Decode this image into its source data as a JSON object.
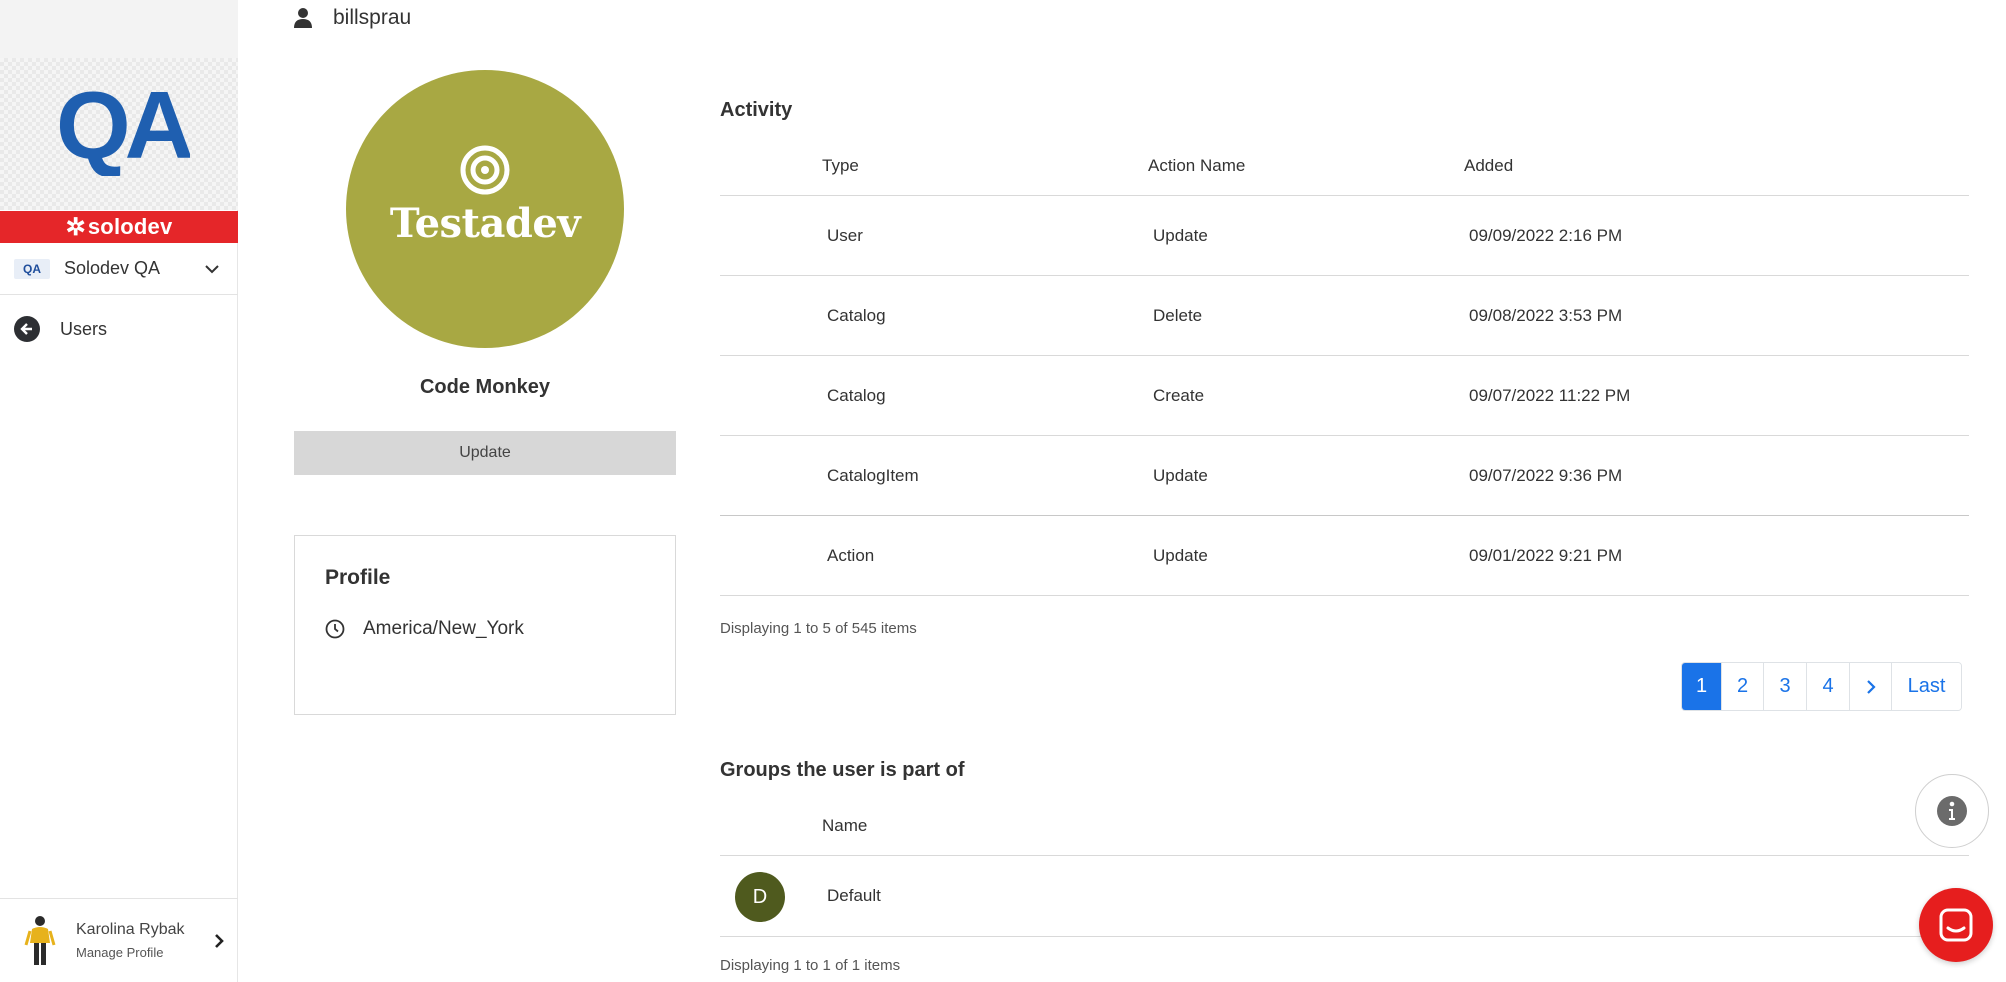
{
  "sidebar": {
    "logo_text": "QA",
    "brand": {
      "name": "solodev",
      "color": "#e52629"
    },
    "org": {
      "badge": "QA",
      "name": "Solodev QA"
    },
    "nav": {
      "back_label": "Users"
    },
    "footer": {
      "user_name": "Karolina Rybak",
      "sub_label": "Manage Profile"
    }
  },
  "header": {
    "username": "billsprau",
    "icon": "user-icon"
  },
  "user_card": {
    "avatar_text": "Testadev",
    "avatar_color": "#a8a843",
    "title": "Code Monkey",
    "update_label": "Update"
  },
  "profile": {
    "title": "Profile",
    "timezone": "America/New_York",
    "icon": "clock-icon"
  },
  "activity": {
    "title": "Activity",
    "columns": [
      "Type",
      "Action Name",
      "Added"
    ],
    "rows": [
      {
        "type": "User",
        "action": "Update",
        "added": "09/09/2022 2:16 PM"
      },
      {
        "type": "Catalog",
        "action": "Delete",
        "added": "09/08/2022 3:53 PM"
      },
      {
        "type": "Catalog",
        "action": "Create",
        "added": "09/07/2022 11:22 PM"
      },
      {
        "type": "CatalogItem",
        "action": "Update",
        "added": "09/07/2022 9:36 PM"
      },
      {
        "type": "Action",
        "action": "Update",
        "added": "09/01/2022 9:21 PM"
      }
    ],
    "summary": "Displaying 1 to 5 of 545 items",
    "pagination": {
      "pages": [
        "1",
        "2",
        "3",
        "4"
      ],
      "next": "›",
      "last": "Last",
      "active": "1",
      "accent": "#1a73e8"
    }
  },
  "groups": {
    "title": "Groups the user is part of",
    "column": "Name",
    "rows": [
      {
        "initial": "D",
        "name": "Default"
      }
    ],
    "summary": "Displaying 1 to 1 of 1 items"
  },
  "fabs": {
    "info_icon": "info-icon",
    "chat_icon": "chat-icon",
    "chat_color": "#e61e1e"
  }
}
